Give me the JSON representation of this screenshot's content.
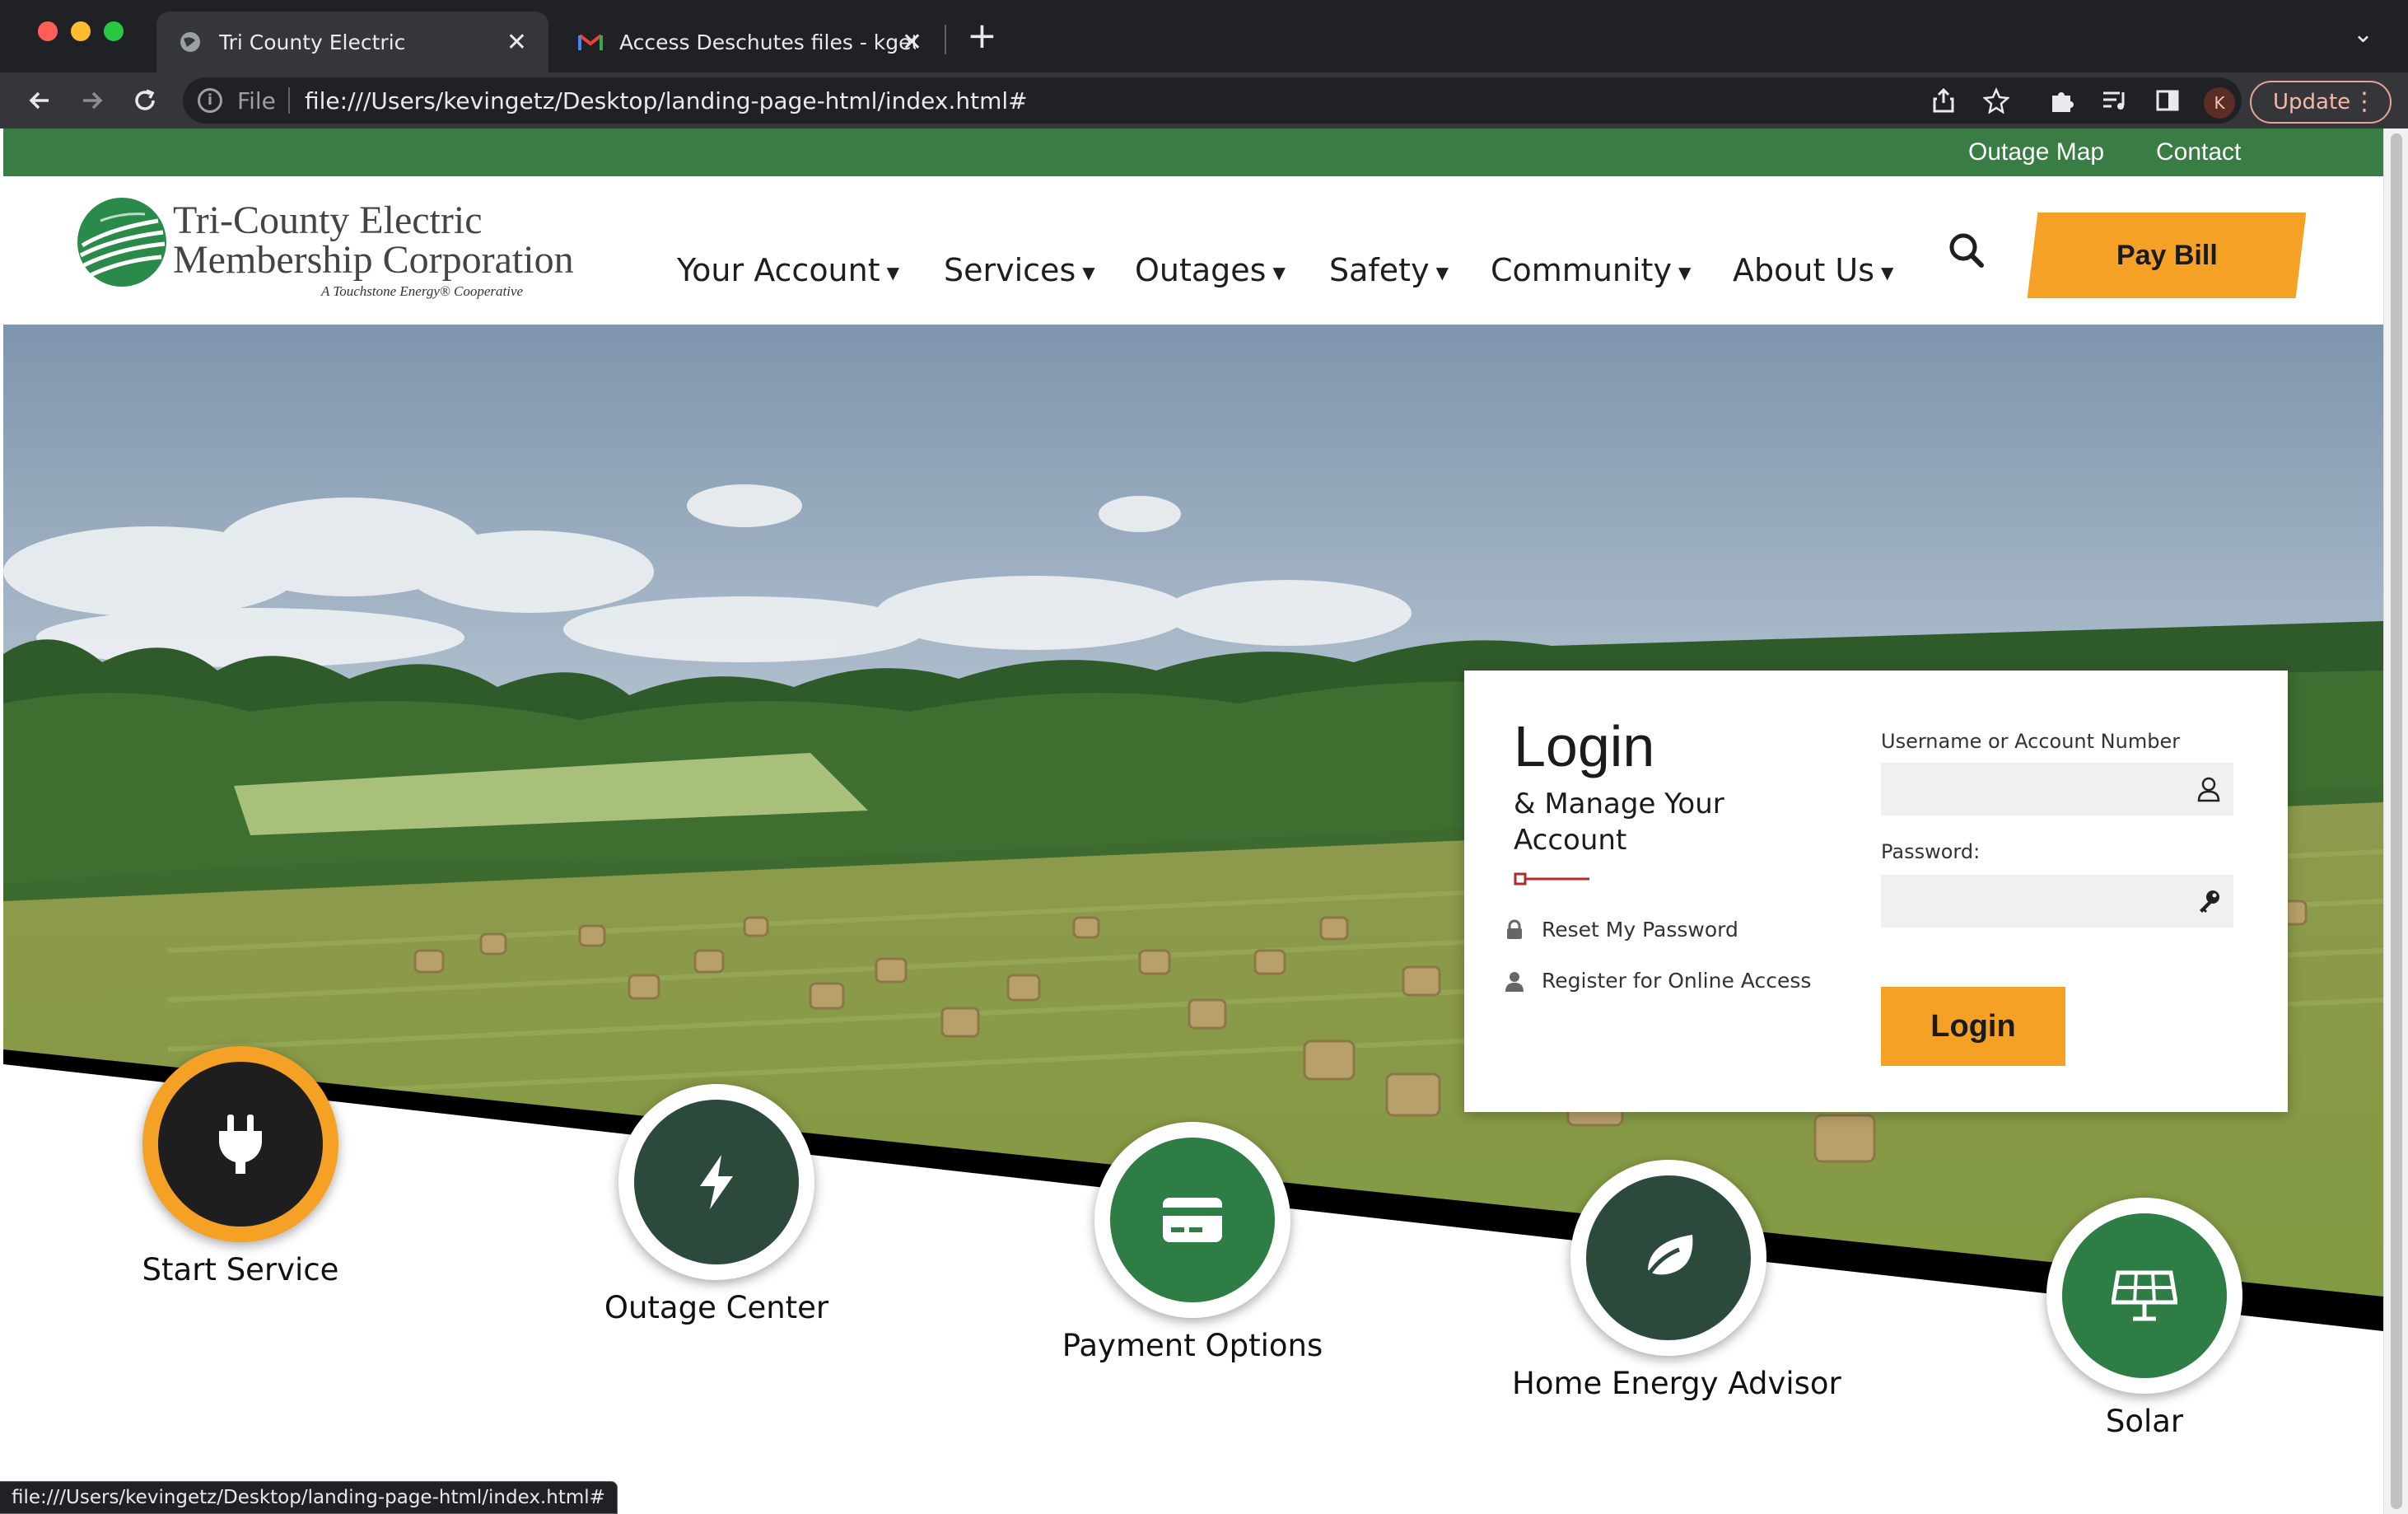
{
  "browser": {
    "tabs": [
      {
        "title": "Tri County Electric",
        "active": true
      },
      {
        "title": "Access Deschutes files - kgetz",
        "active": false
      }
    ],
    "url_scheme": "File",
    "url": "file:///Users/kevingetz/Desktop/landing-page-html/index.html#",
    "profile_initial": "K",
    "update_label": "Update",
    "status_url": "file:///Users/kevingetz/Desktop/landing-page-html/index.html#"
  },
  "utility_nav": [
    "Outage Map",
    "Contact"
  ],
  "logo": {
    "line1": "Tri-County Electric",
    "line2": "Membership Corporation",
    "tagline": "A Touchstone Energy® Cooperative"
  },
  "main_nav": [
    "Your Account",
    "Services",
    "Outages",
    "Safety",
    "Community",
    "About Us"
  ],
  "pay_bill_label": "Pay Bill",
  "login": {
    "title": "Login",
    "subtitle": "& Manage Your Account",
    "links": [
      "Reset My Password",
      "Register for Online Access"
    ],
    "username_label": "Username or Account Number",
    "username_value": "",
    "password_label": "Password:",
    "password_value": "",
    "button": "Login"
  },
  "quick_links": [
    {
      "label": "Start Service",
      "icon": "plug-icon",
      "active": true
    },
    {
      "label": "Outage Center",
      "icon": "lightning-icon",
      "active": false
    },
    {
      "label": "Payment Options",
      "icon": "credit-card-icon",
      "active": false
    },
    {
      "label": "Home Energy Advisor",
      "icon": "leaf-icon",
      "active": false
    },
    {
      "label": "Solar",
      "icon": "solar-panel-icon",
      "active": false
    }
  ],
  "colors": {
    "brand_green": "#3a7d44",
    "accent_orange": "#f4a125",
    "dark_green": "#2c4a3c",
    "mid_green": "#2e7d45"
  }
}
